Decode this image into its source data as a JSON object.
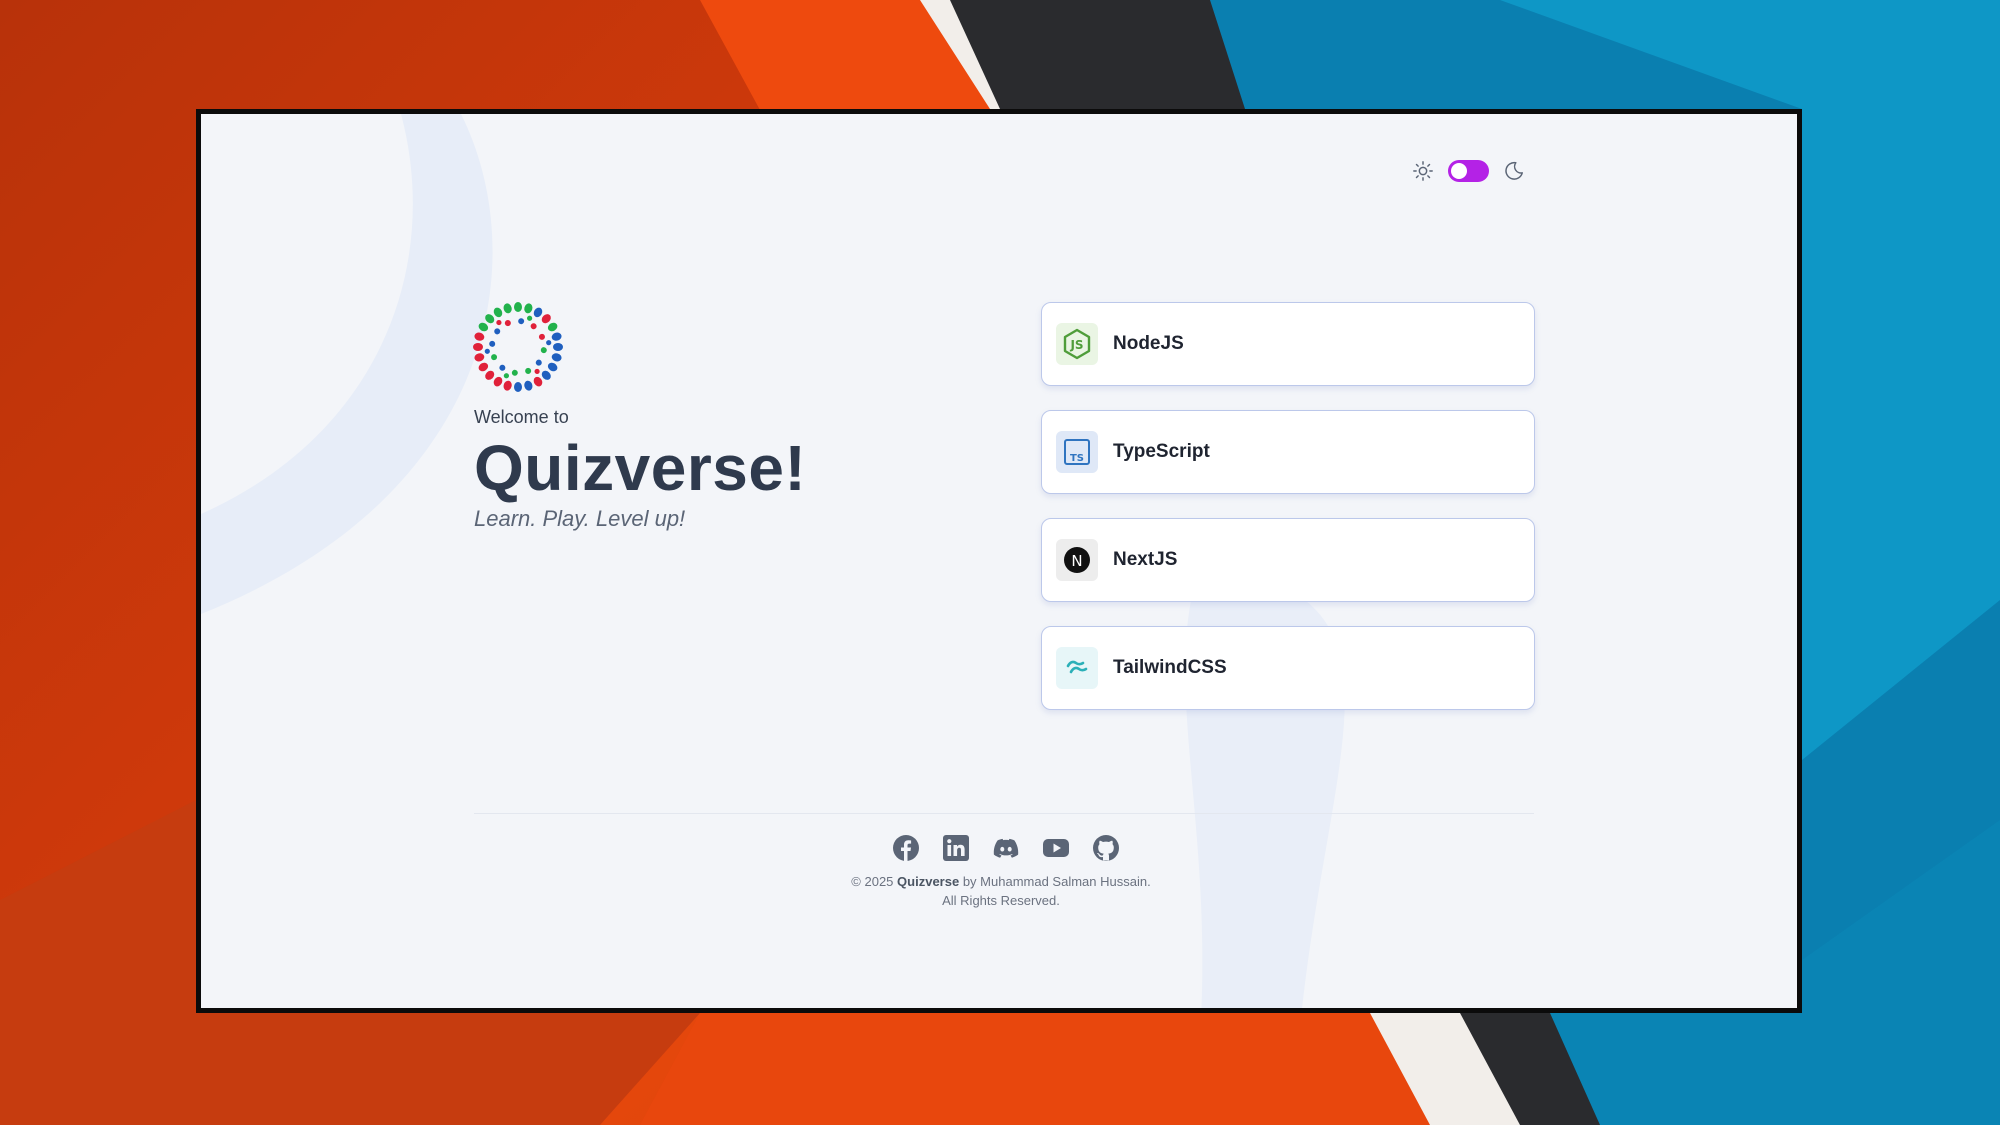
{
  "theme_toggle": {
    "light_icon": "sun-icon",
    "dark_icon": "moon-icon",
    "switch_color": "#b422e6"
  },
  "hero": {
    "logo": "quizverse-logo",
    "welcome": "Welcome to",
    "title": "Quizverse!",
    "tagline": "Learn. Play. Level up!"
  },
  "topics": [
    {
      "label": "NodeJS",
      "icon": "nodejs-icon"
    },
    {
      "label": "TypeScript",
      "icon": "typescript-icon"
    },
    {
      "label": "NextJS",
      "icon": "nextjs-icon"
    },
    {
      "label": "TailwindCSS",
      "icon": "tailwindcss-icon"
    }
  ],
  "socials": [
    "facebook-icon",
    "linkedin-icon",
    "discord-icon",
    "youtube-icon",
    "github-icon"
  ],
  "footer": {
    "copyright": "© 2025",
    "brand": "Quizverse",
    "author": "by Muhammad Salman Hussain.",
    "rights": "All Rights Reserved."
  },
  "colors": {
    "accent": "#b422e6",
    "title": "#2f3a4d",
    "card_border": "#bcc8ea"
  }
}
